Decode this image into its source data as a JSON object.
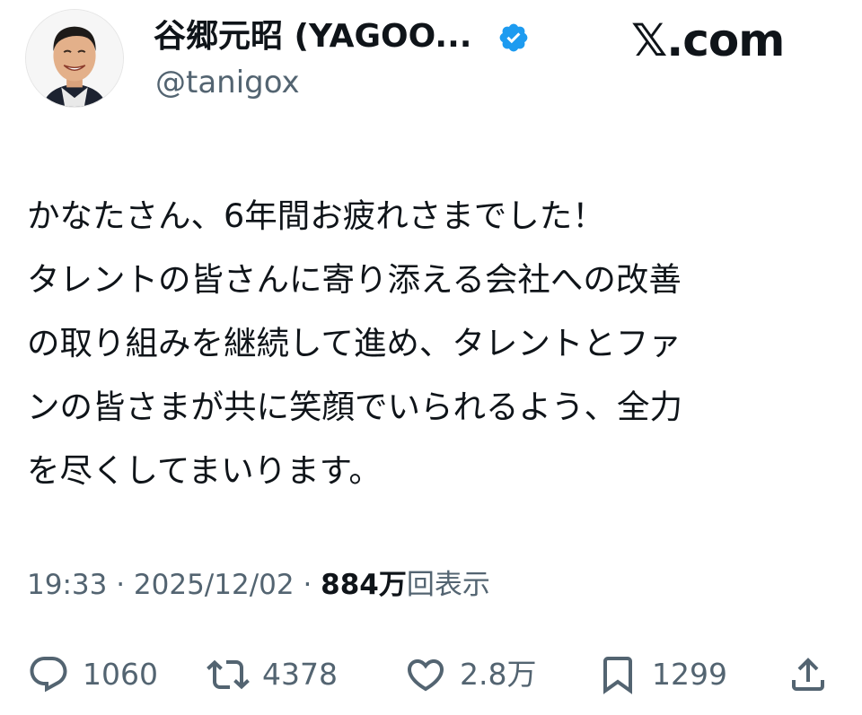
{
  "header": {
    "display_name": "谷郷元昭 (YAGOO...",
    "handle": "@tanigox",
    "brand": "𝕏.com",
    "verified": true
  },
  "tweet": {
    "lines": [
      "かなたさん、6年間お疲れさまでした！",
      "タレントの皆さんに寄り添える会社への改善",
      "の取り組みを継続して進め、タレントとファ",
      "ンの皆さまが共に笑顔でいられるよう、全力",
      "を尽くしてまいります。"
    ]
  },
  "meta": {
    "time": "19:33",
    "separator": " · ",
    "date": "2025/12/02",
    "views_count": "884万",
    "views_label": "回表示"
  },
  "actions": {
    "replies": "1060",
    "reposts": "4378",
    "likes": "2.8万",
    "bookmarks": "1299"
  },
  "colors": {
    "text": "#0f1419",
    "secondary": "#536471",
    "verified": "#1d9bf0"
  },
  "icons": [
    "reply-icon",
    "repost-icon",
    "like-icon",
    "bookmark-icon",
    "share-icon",
    "verified-badge-icon"
  ]
}
